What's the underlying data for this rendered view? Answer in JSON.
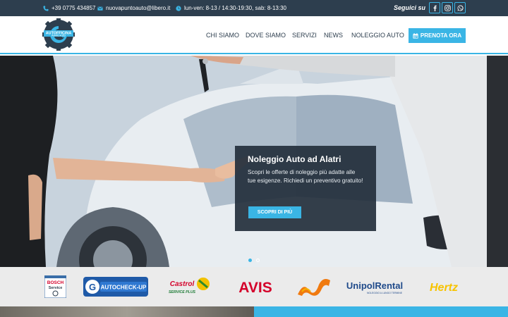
{
  "topbar": {
    "phone": "+39 0775 434857",
    "email": "nuovapuntoauto@libero.it",
    "hours": "lun-ven: 8-13 / 14:30-19:30, sab: 8-13:30",
    "follow_label": "Seguici su",
    "social_icons": [
      "facebook-icon",
      "instagram-icon",
      "whatsapp-icon"
    ]
  },
  "header": {
    "logo_text_top": "AUTOFFICINA",
    "logo_text_bottom": "PUNTO AUTO",
    "nav": [
      "CHI SIAMO",
      "DOVE SIAMO",
      "SERVIZI",
      "NEWS",
      "NOLEGGIO AUTO"
    ],
    "cta_label": "PRENOTA ORA"
  },
  "hero": {
    "title": "Noleggio Auto ad Alatri",
    "text": "Scopri le offerte di noleggio più adatte alle tue esigenze. Richiedi un preventivo gratuito!",
    "button_label": "SCOPRI DI PIÙ",
    "slides_total": 2,
    "active_slide": 1
  },
  "partners": {
    "bosch_line1": "BOSCH",
    "bosch_line2": "Service",
    "autocheckup": "AUTOCHECK-UP",
    "castrol": "Castrol",
    "castrol_sub": "SERVICE PLUS",
    "avis": "AVIS",
    "unipol": "UnipolRental",
    "unipol_sub": "NOLEGGIO A LUNGO TERMINE",
    "hertz": "Hertz"
  },
  "colors": {
    "accent": "#3ab5e5",
    "dark": "#2d3e4e",
    "avis_red": "#d4002a",
    "hertz_yellow": "#f7c300"
  }
}
